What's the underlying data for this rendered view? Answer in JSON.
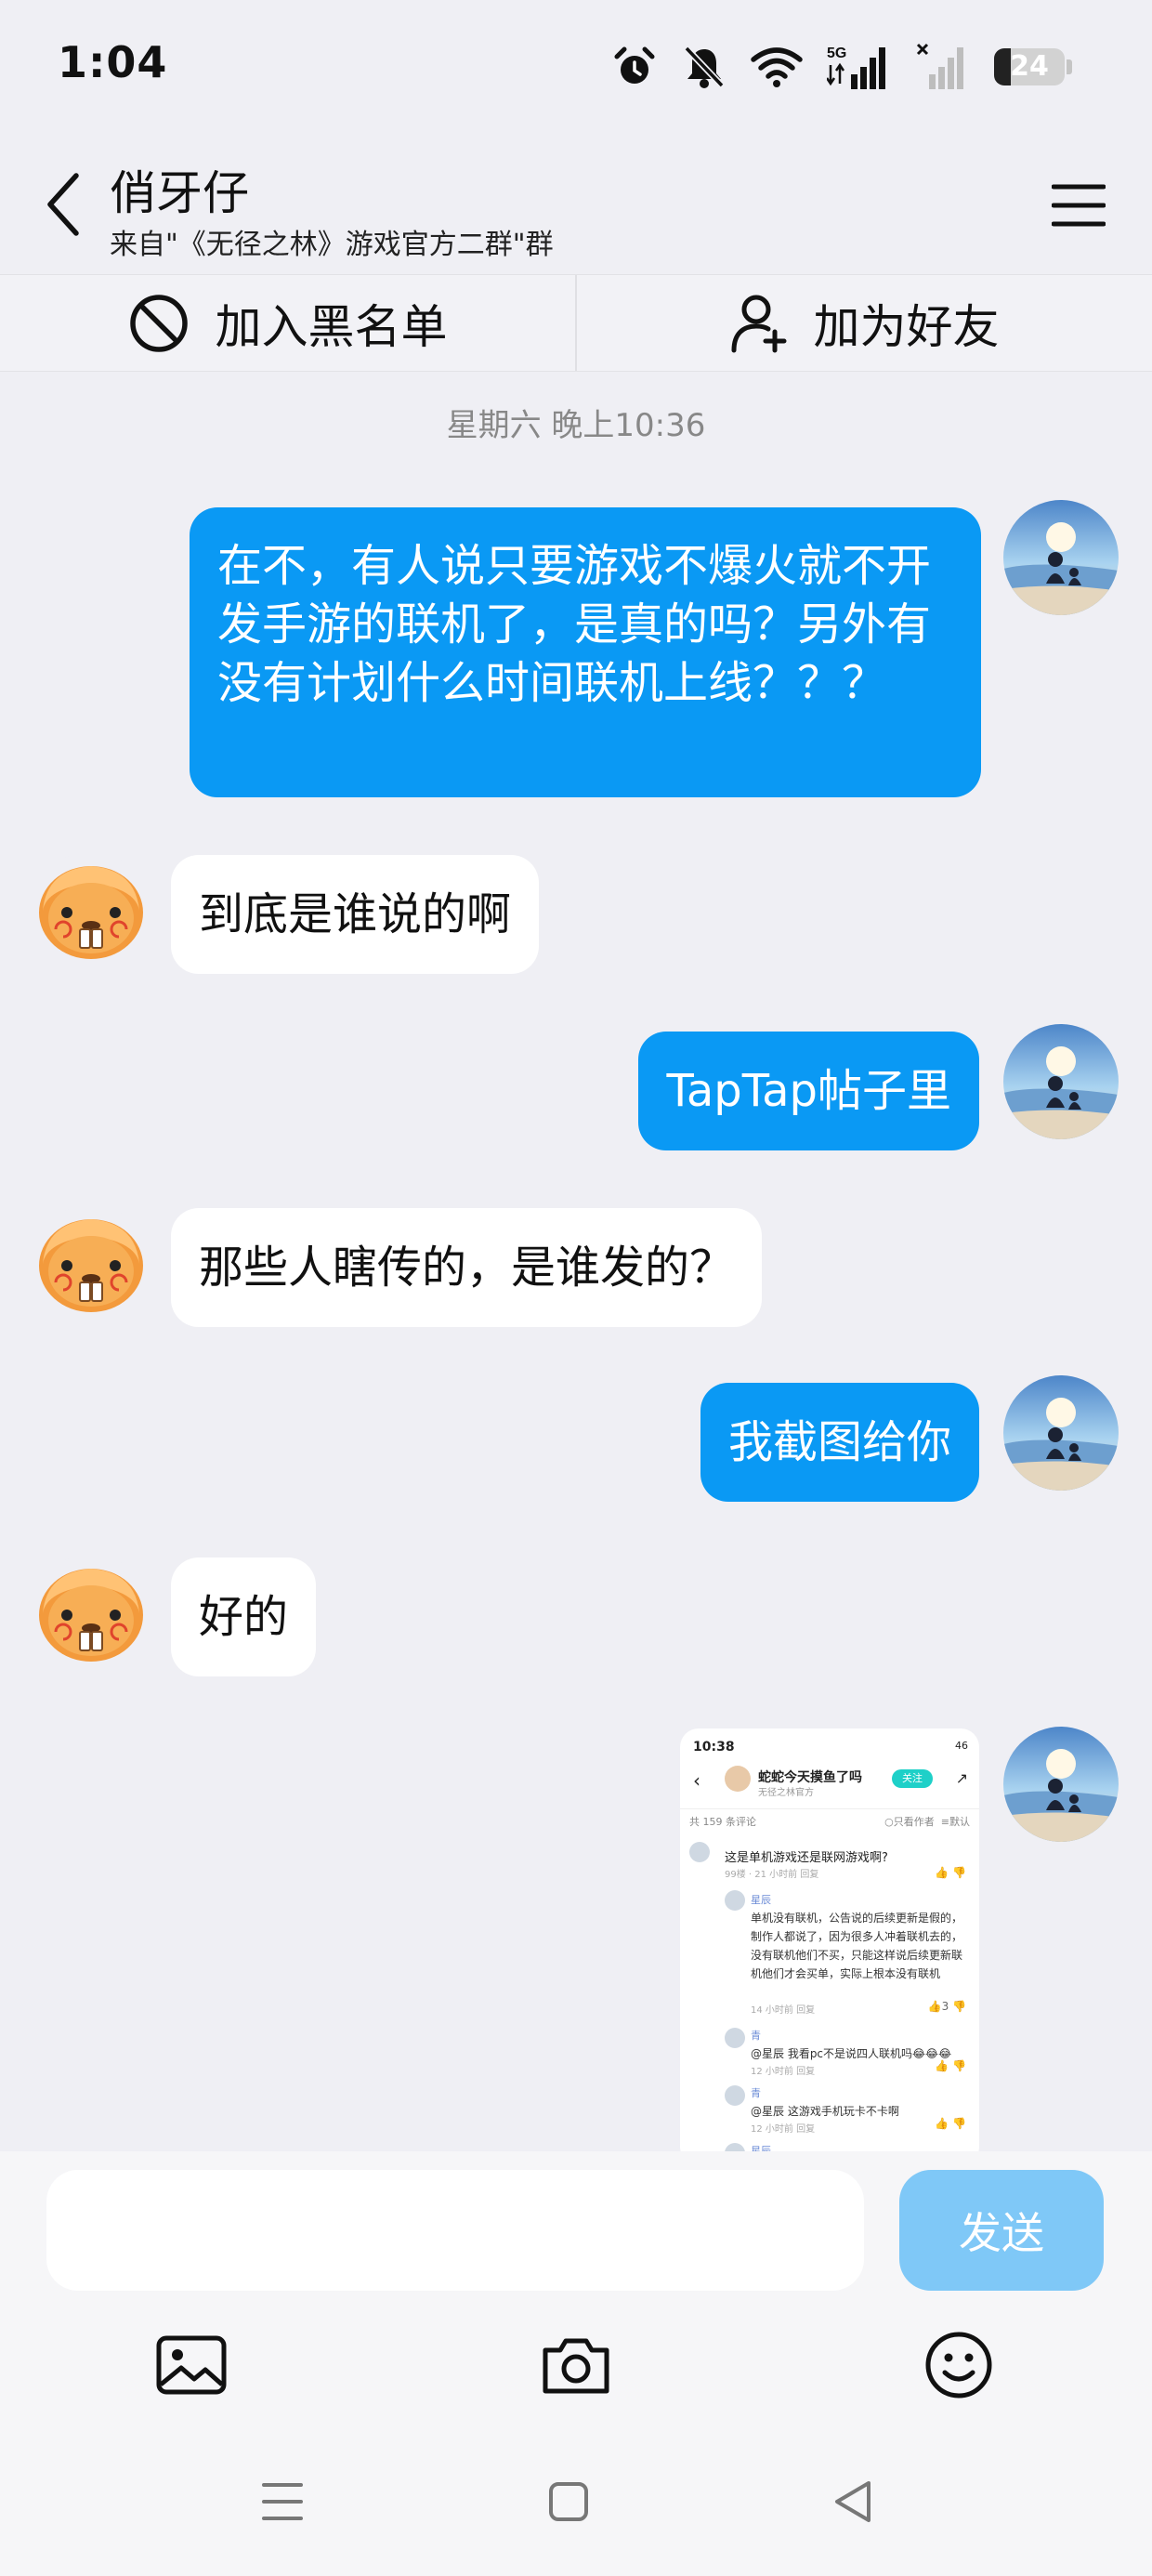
{
  "status_bar": {
    "time": "1:04",
    "network": "5G",
    "battery": "24",
    "battery_level": 0.24
  },
  "header": {
    "title": "俏牙仔",
    "subtitle": "来自\"《无径之林》游戏官方二群\"群"
  },
  "actions": {
    "block_label": "加入黑名单",
    "add_friend_label": "加为好友"
  },
  "chat": {
    "timestamp": "星期六 晚上10:36",
    "messages": [
      {
        "side": "out",
        "text": "在不，有人说只要游戏不爆火就不开发手游的联机了，是真的吗？另外有没有计划什么时间联机上线？？？"
      },
      {
        "side": "in",
        "text": "到底是谁说的啊"
      },
      {
        "side": "out",
        "text": "TapTap帖子里"
      },
      {
        "side": "in",
        "text": "那些人瞎传的，是谁发的？"
      },
      {
        "side": "out",
        "text": "我截图给你"
      },
      {
        "side": "in",
        "text": "好的"
      }
    ],
    "screenshot": {
      "time": "10:38",
      "status": "46",
      "author": "蛇蛇今天摸鱼了吗",
      "author_sub": "无径之林官方",
      "follow": "关注",
      "comment_count": "共 159 条评论",
      "only_author": "只看作者",
      "sort": "默认",
      "question": "这是单机游戏还是联网游戏啊?",
      "question_meta": "99楼 · 21 小时前  回复",
      "reply1_name": "星辰",
      "reply1_text": "单机没有联机，公告说的后续更新是假的，制作人都说了，因为很多人冲着联机去的，没有联机他们不买，只能这样说后续更新联机他们才会买单，实际上根本没有联机",
      "reply1_meta": "14 小时前  回复",
      "reply1_likes": "3",
      "reply2_name": "青",
      "reply2_text": "@星辰  我看pc不是说四人联机吗😂😂😂",
      "reply2_meta": "12 小时前  回复",
      "reply3_name": "青",
      "reply3_text": "@星辰  这游戏手机玩卡不卡啊",
      "reply3_meta": "12 小时前  回复",
      "reply4_name": "星辰"
    }
  },
  "composer": {
    "input_value": "",
    "send_label": "发送"
  },
  "colors": {
    "outgoing_bubble": "#0A99F4",
    "incoming_bubble": "#FFFFFF",
    "send_button": "#7FC8F7",
    "background": "#EFEFF4"
  },
  "icons": {
    "back": "chevron-left-icon",
    "menu": "hamburger-menu-icon",
    "block": "block-circle-icon",
    "add_friend": "add-person-icon",
    "image": "image-icon",
    "camera": "camera-icon",
    "emoji": "emoji-icon"
  }
}
